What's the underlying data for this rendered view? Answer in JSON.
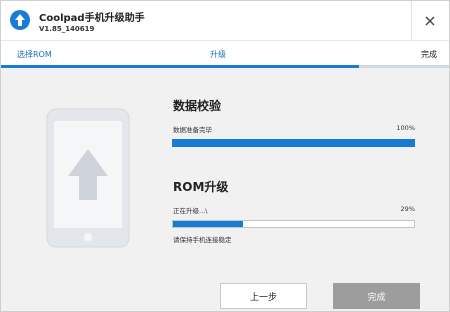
{
  "window": {
    "title": "Coolpad手机升级助手",
    "version": "V1.85_140619"
  },
  "steps": {
    "items": [
      {
        "label": "选择ROM"
      },
      {
        "label": "升级"
      },
      {
        "label": "完成"
      }
    ],
    "progress": 0.8
  },
  "verify": {
    "title": "数据校验",
    "status": "数据准备完毕",
    "percent_label": "100%",
    "progress": 1.0
  },
  "upgrade": {
    "title": "ROM升级",
    "status": "正在升级...\\",
    "percent_label": "29%",
    "progress": 0.29,
    "notice": "请保持手机连接稳定"
  },
  "buttons": {
    "prev": "上一步",
    "done": "完成"
  },
  "colors": {
    "accent": "#1a7bd5",
    "disabled_button": "#9d9d9d"
  }
}
